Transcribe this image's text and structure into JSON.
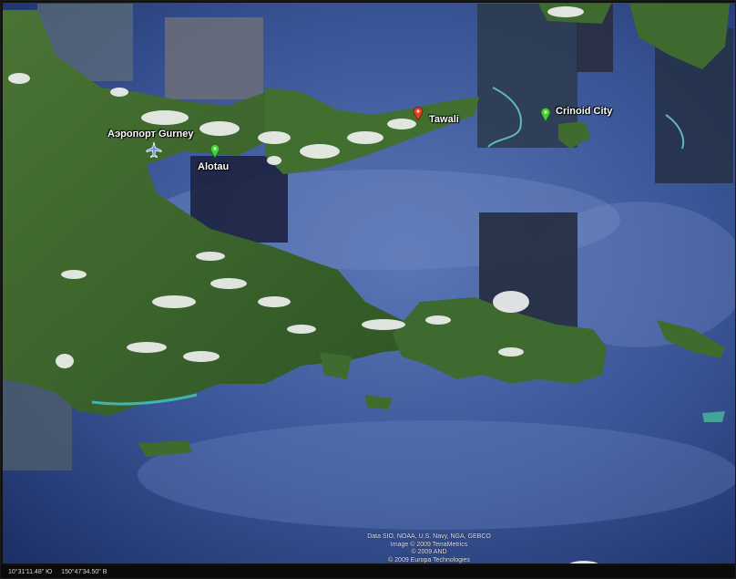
{
  "map": {
    "places": [
      {
        "id": "airport",
        "label": "Аэропорт Gurney",
        "icon": "airplane-icon"
      },
      {
        "id": "alotau",
        "label": "Alotau",
        "icon": "green-pin-icon"
      },
      {
        "id": "tawali",
        "label": "Tawali",
        "icon": "red-pin-icon"
      },
      {
        "id": "crinoid",
        "label": "Crinoid City",
        "icon": "green-pin-icon"
      }
    ],
    "attribution": [
      "Data SIO, NOAA, U.S. Navy, NGA, GEBCO",
      "Image © 2009 TerraMetrics",
      "© 2009 AND",
      "© 2009 Europa Technologies"
    ],
    "status": {
      "latitude": "10°31'11.48\" Ю",
      "longitude": "150°47'34.50\" В"
    },
    "colors": {
      "ocean": "#2f4b8c",
      "land": "#3f6a2e",
      "cloud": "#f2f2f2",
      "pin_green": "#46d13a",
      "pin_red": "#e0402a"
    }
  }
}
